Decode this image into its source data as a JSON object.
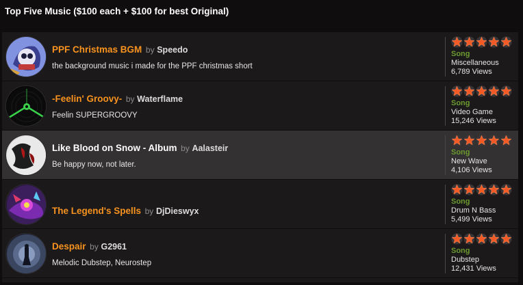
{
  "section_title": "Top Five Music ($100 each + $100 for best Original)",
  "by_label": "by",
  "colors": {
    "title_orange": "#f7931e",
    "title_white": "#ffffff",
    "type_green": "#6b9b2f",
    "star_fill": "#f15a24",
    "row_bg": "#1c191b",
    "row_bg_highlight": "#343133"
  },
  "items": [
    {
      "title": "PPF Christmas BGM",
      "title_color": "#f7931e",
      "author": "Speedo",
      "description": "the background music i made for the PPF christmas short",
      "type": "Song",
      "genre": "Miscellaneous",
      "views": "6,789 Views",
      "rating_stars": 5,
      "icon": "cartoon-character-thumbnail",
      "highlight": false
    },
    {
      "title": "-Feelin' Groovy-",
      "title_color": "#f7931e",
      "author": "Waterflame",
      "description": "Feelin SUPERGROOVY",
      "type": "Song",
      "genre": "Video Game",
      "views": "15,246 Views",
      "rating_stars": 5,
      "icon": "green-vinyl-thumbnail",
      "highlight": false
    },
    {
      "title": "Like Blood on Snow - Album",
      "title_color": "#ffffff",
      "author": "Aalasteir",
      "description": "Be happy now, not later.",
      "type": "Song",
      "genre": "New Wave",
      "views": "4,106 Views",
      "rating_stars": 5,
      "icon": "blood-snow-thumbnail",
      "highlight": true
    },
    {
      "title": "The Legend's Spells",
      "title_color": "#f7931e",
      "author": "DjDieswyx",
      "description": "",
      "type": "Song",
      "genre": "Drum N Bass",
      "views": "5,499 Views",
      "rating_stars": 5,
      "icon": "purple-spell-thumbnail",
      "highlight": false
    },
    {
      "title": "Despair",
      "title_color": "#f7931e",
      "author": "G2961",
      "description": "Melodic Dubstep, Neurostep",
      "type": "Song",
      "genre": "Dubstep",
      "views": "12,431 Views",
      "rating_stars": 5,
      "icon": "dark-figure-thumbnail",
      "highlight": false
    }
  ]
}
